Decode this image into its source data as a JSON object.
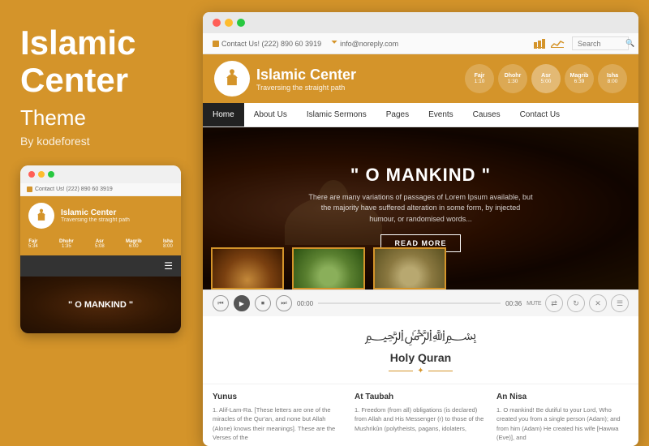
{
  "left": {
    "title": "Islamic\nCenter",
    "subtitle": "Theme",
    "by": "By kodeforest"
  },
  "mobile": {
    "contact": "Contact Us! (222) 890 60 3919",
    "site_title": "Islamic Center",
    "site_tagline": "Traversing the straight path",
    "hero_text": "\" O MANKIND \"",
    "prayer_times": [
      {
        "name": "Fajr",
        "time": "5:34"
      },
      {
        "name": "Dhuhr",
        "time": "1:35"
      },
      {
        "name": "Asr",
        "time": "5:08"
      },
      {
        "name": "Magrib",
        "time": "6:00"
      },
      {
        "name": "Isha",
        "time": "8:00"
      }
    ]
  },
  "browser": {
    "utility": {
      "contact": "Contact Us! (222) 890 60 3919",
      "email": "info@noreply.com",
      "search_placeholder": "Search"
    },
    "header": {
      "site_title": "Islamic Center",
      "site_tagline": "Traversing the straight path",
      "prayer_times": [
        {
          "name": "Fajr",
          "time": "1:10"
        },
        {
          "name": "Dhohr",
          "time": "1:30"
        },
        {
          "name": "Asr",
          "time": "5:00"
        },
        {
          "name": "Magrib",
          "time": "6:39"
        },
        {
          "name": "Isha",
          "time": "8:00"
        }
      ]
    },
    "nav": {
      "items": [
        "Home",
        "About Us",
        "Islamic Sermons",
        "Pages",
        "Events",
        "Causes",
        "Contact Us"
      ],
      "active": "Home"
    },
    "hero": {
      "quote": "\" O MANKIND \"",
      "description": "There are many variations of passages of Lorem Ipsum available, but the majority have suffered alteration in some form, by injected humour, or randomised words...",
      "button": "READ MORE"
    },
    "audio": {
      "time_start": "00:00",
      "time_end": "00:36",
      "mute": "MUTE"
    },
    "quran": {
      "arabic": "﷽",
      "title": "Holy Quran"
    },
    "columns": [
      {
        "title": "Yunus",
        "text": "1. Alif-Lam-Ra. [These letters are one of the miracles of the Qur'an, and none but Allah (Alone) knows their meanings]. These are the Verses of the"
      },
      {
        "title": "At Taubah",
        "text": "1. Freedom (from all) obligations (is declared) from Allah and His Messenger (r) to those of the Mushrikûn (polytheists, pagans, idolaters,"
      },
      {
        "title": "An Nisa",
        "text": "1. O mankind! Be dutiful to your Lord, Who created you from a single person (Adam); and from him (Adam) He created his wife [Hawwa (Eve)], and"
      }
    ]
  }
}
